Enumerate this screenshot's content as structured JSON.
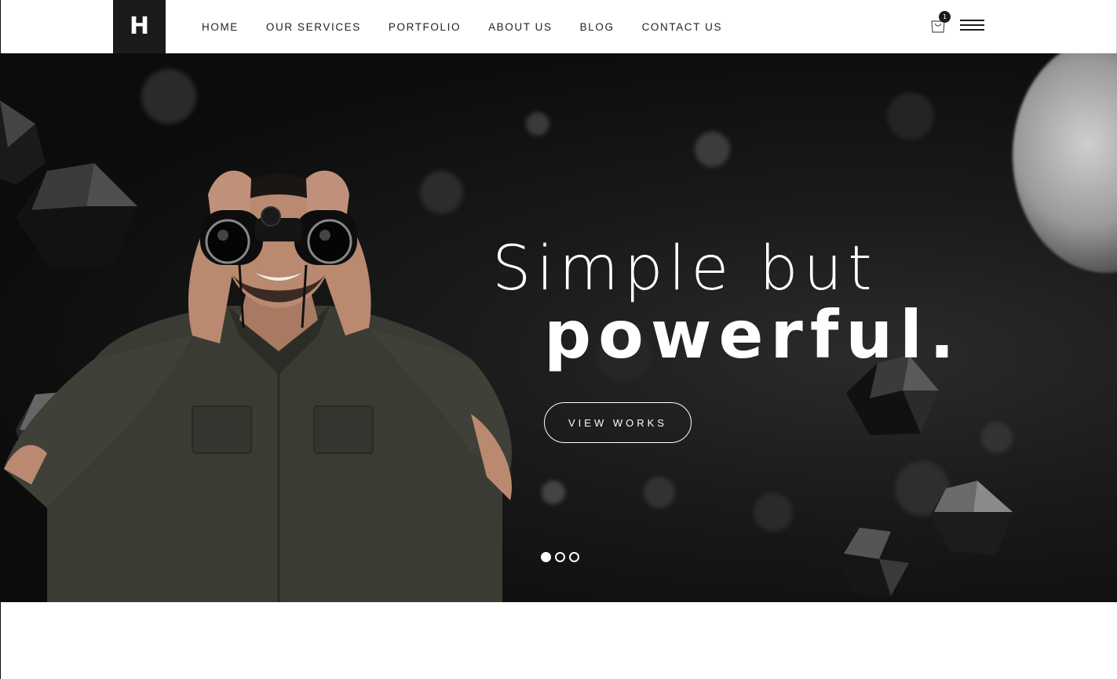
{
  "header": {
    "logo_letter": "H",
    "nav": [
      "HOME",
      "OUR SERVICES",
      "PORTFOLIO",
      "ABOUT US",
      "BLOG",
      "CONTACT US"
    ],
    "cart_count": "1",
    "cart_icon": "shopping-bag-icon",
    "menu_icon": "hamburger-menu-icon"
  },
  "hero": {
    "title_light": "Simple but",
    "title_bold": "powerful.",
    "button_label": "VIEW WORKS",
    "slides": 3,
    "active_slide": 1
  },
  "colors": {
    "dark": "#1b1b1b",
    "hero_bg": "#111111",
    "text_light": "#ffffff"
  }
}
